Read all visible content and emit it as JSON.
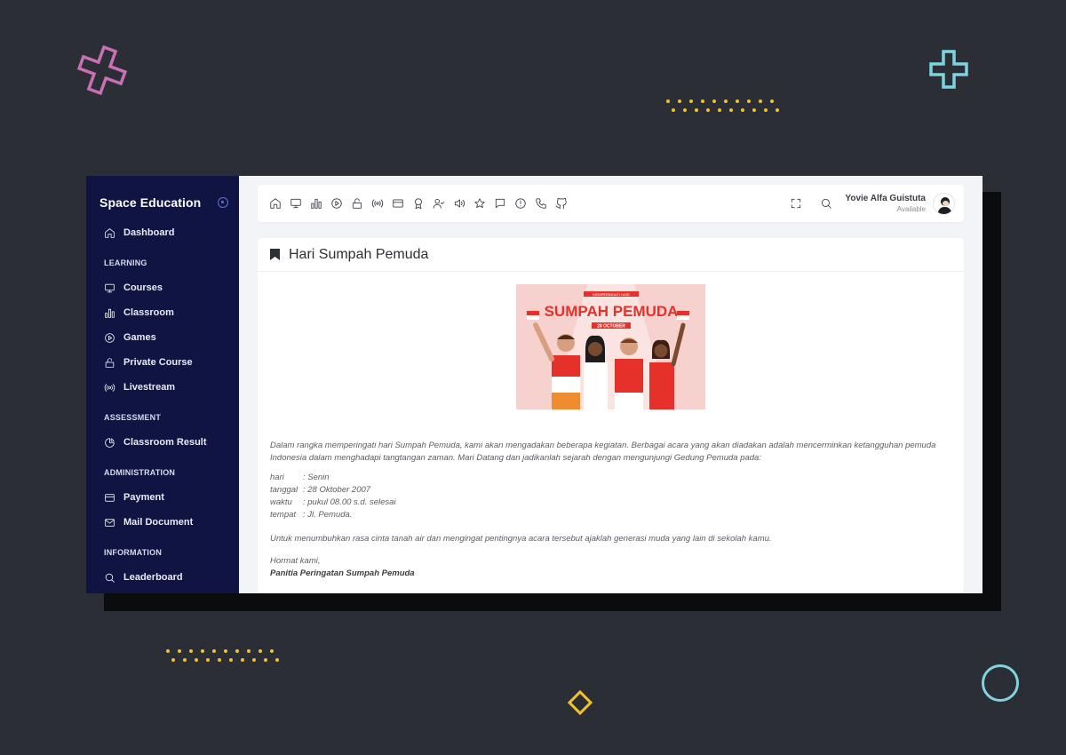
{
  "colors": {
    "background": "#2b2e34",
    "sidebar": "#0f1442",
    "accent_dots": "#f2c12e",
    "deco_pink": "#c86fb5",
    "deco_teal": "#7fd3df"
  },
  "sidebar": {
    "brand": "Space Education",
    "dashboard": {
      "label": "Dashboard",
      "icon": "home-icon"
    },
    "sections": [
      {
        "label": "LEARNING",
        "items": [
          {
            "label": "Courses",
            "icon": "monitor-icon"
          },
          {
            "label": "Classroom",
            "icon": "bar-chart-icon"
          },
          {
            "label": "Games",
            "icon": "play-circle-icon"
          },
          {
            "label": "Private Course",
            "icon": "lock-icon"
          },
          {
            "label": "Livestream",
            "icon": "broadcast-icon"
          }
        ]
      },
      {
        "label": "ASSESSMENT",
        "items": [
          {
            "label": "Classroom Result",
            "icon": "pie-chart-icon"
          }
        ]
      },
      {
        "label": "ADMINISTRATION",
        "items": [
          {
            "label": "Payment",
            "icon": "credit-card-icon"
          },
          {
            "label": "Mail Document",
            "icon": "mail-icon"
          }
        ]
      },
      {
        "label": "INFORMATION",
        "items": [
          {
            "label": "Leaderboard",
            "icon": "search-icon"
          }
        ]
      }
    ]
  },
  "topbar": {
    "icons": [
      "home-icon",
      "monitor-icon",
      "bar-chart-icon",
      "play-circle-icon",
      "lock-icon",
      "broadcast-icon",
      "credit-card-icon",
      "award-icon",
      "user-check-icon",
      "volume-icon",
      "star-icon",
      "message-icon",
      "alert-circle-icon",
      "phone-icon",
      "github-icon"
    ],
    "tools": [
      "fullscreen-icon",
      "search-icon"
    ],
    "user_name": "Yovie Alfa Guistuta",
    "user_status": "Available"
  },
  "card": {
    "title": "Hari Sumpah Pemuda",
    "banner": {
      "small_text": "MEMPERINGATI HARI",
      "title": "SUMPAH PEMUDA",
      "date": "28 OCTOBER"
    },
    "paragraph1": "Dalam rangka memperingati hari Sumpah Pemuda, kami akan mengadakan beberapa kegiatan. Berbagai acara yang akan diadakan adalah mencerminkan ketangguhan pemuda Indonesia dalam menghadapi tangtangan zaman. Mari Datang dan jadikanlah sejarah dengan mengunjungi Gedung Pemuda pada:",
    "details": [
      {
        "key": "hari",
        "value": ": Senin"
      },
      {
        "key": "tanggal",
        "value": ": 28 Oktober 2007"
      },
      {
        "key": "waktu",
        "value": ": pukul 08.00 s.d. selesai"
      },
      {
        "key": "tempat",
        "value": ": Jl. Pemuda."
      }
    ],
    "paragraph2": "Untuk menumbuhkan rasa cinta tanah air dan mengingat pentingnya acara tersebut ajaklah generasi muda yang lain di sekolah kamu.",
    "closing": "Hormat kami,",
    "organizer": "Panitia Peringatan Sumpah Pemuda"
  }
}
